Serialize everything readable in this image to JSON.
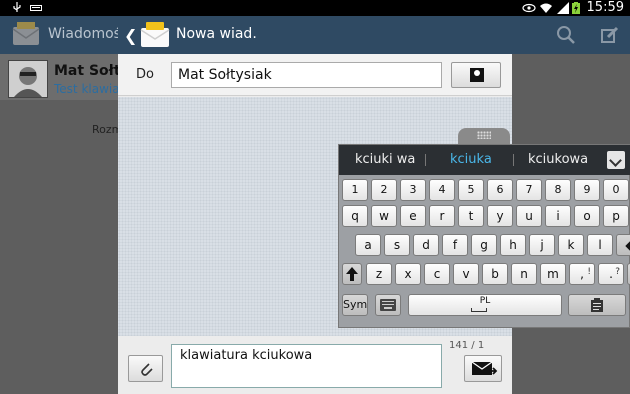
{
  "status_bar": {
    "time": "15:59"
  },
  "background_app": {
    "title": "Wiadomośc",
    "contact_name": "Mat Sołtys",
    "contact_sub": "Test klawiat",
    "snippet": "Rozm"
  },
  "dialog": {
    "title": "Nowa wiad.",
    "to_label": "Do",
    "to_value": "Mat Sołtysiak",
    "message_text": "klawiatura kciukowa",
    "counter": "141 / 1"
  },
  "keyboard": {
    "suggestions": [
      "kciuki wa",
      "kciuka",
      "kciukowa"
    ],
    "selected_suggestion": "kciuka",
    "row_numbers": [
      "1",
      "2",
      "3",
      "4",
      "5",
      "6",
      "7",
      "8",
      "9",
      "0"
    ],
    "row_top": [
      "q",
      "w",
      "e",
      "r",
      "t",
      "y",
      "u",
      "i",
      "o",
      "p"
    ],
    "row_mid": [
      "a",
      "s",
      "d",
      "f",
      "g",
      "h",
      "j",
      "k",
      "l"
    ],
    "row_bottom": [
      "z",
      "x",
      "c",
      "v",
      "b",
      "n",
      "m",
      ",",
      "."
    ],
    "row_bottom_superscripts": [
      "!",
      "?"
    ],
    "sym_label": "Sym",
    "space_label": "PL",
    "accent_color": "#4ab6e8"
  }
}
